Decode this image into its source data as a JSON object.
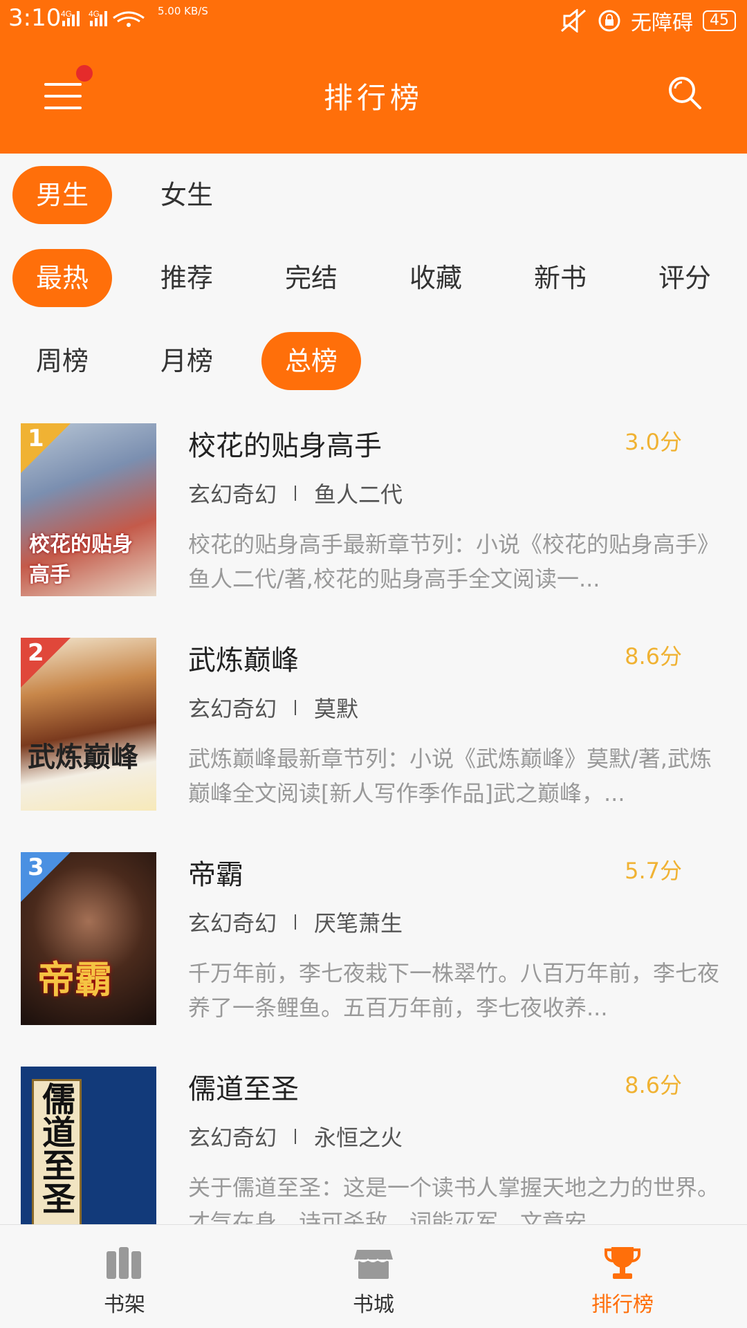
{
  "status_bar": {
    "time": "3:10",
    "network": "4G 4G",
    "speed": "5.00 KB/S",
    "accessibility": "无障碍",
    "battery": "45"
  },
  "header": {
    "title": "排行榜",
    "menu_icon": "hamburger-menu-icon",
    "search_icon": "search-icon",
    "accent_color": "#ff6f0a"
  },
  "filters": {
    "gender": [
      {
        "label": "男生",
        "active": true
      },
      {
        "label": "女生",
        "active": false
      }
    ],
    "category": [
      {
        "label": "最热",
        "active": true
      },
      {
        "label": "推荐",
        "active": false
      },
      {
        "label": "完结",
        "active": false
      },
      {
        "label": "收藏",
        "active": false
      },
      {
        "label": "新书",
        "active": false
      },
      {
        "label": "评分",
        "active": false
      }
    ],
    "period": [
      {
        "label": "周榜",
        "active": false
      },
      {
        "label": "月榜",
        "active": false
      },
      {
        "label": "总榜",
        "active": true
      }
    ]
  },
  "books": [
    {
      "rank": "1",
      "title": "校花的贴身高手",
      "score": "3.0分",
      "genre": "玄幻奇幻",
      "author": "鱼人二代",
      "desc": "校花的贴身高手最新章节列：小说《校花的贴身高手》鱼人二代/著,校花的贴身高手全文阅读一...",
      "cover_text": "校花的贴身高手",
      "flag_color": "#f0b233"
    },
    {
      "rank": "2",
      "title": "武炼巅峰",
      "score": "8.6分",
      "genre": "玄幻奇幻",
      "author": "莫默",
      "desc": "武炼巅峰最新章节列：小说《武炼巅峰》莫默/著,武炼巅峰全文阅读[新人写作季作品]武之巅峰，...",
      "cover_text": "武炼巅峰",
      "flag_color": "#e0473a"
    },
    {
      "rank": "3",
      "title": "帝霸",
      "score": "5.7分",
      "genre": "玄幻奇幻",
      "author": "厌笔萧生",
      "desc": "千万年前，李七夜栽下一株翠竹。八百万年前，李七夜养了一条鲤鱼。五百万年前，李七夜收养...",
      "cover_text": "帝霸",
      "flag_color": "#4a90e2"
    },
    {
      "rank": "",
      "title": "儒道至圣",
      "score": "8.6分",
      "genre": "玄幻奇幻",
      "author": "永恒之火",
      "desc": "关于儒道至圣：这是一个读书人掌握天地之力的世界。才气在身，诗可杀敌，词能灭军，文章安...",
      "cover_text": "儒道至圣",
      "flag_color": ""
    }
  ],
  "bottom_nav": [
    {
      "label": "书架",
      "icon": "bookshelf-icon",
      "active": false
    },
    {
      "label": "书城",
      "icon": "bookstore-icon",
      "active": false
    },
    {
      "label": "排行榜",
      "icon": "trophy-icon",
      "active": true
    }
  ]
}
